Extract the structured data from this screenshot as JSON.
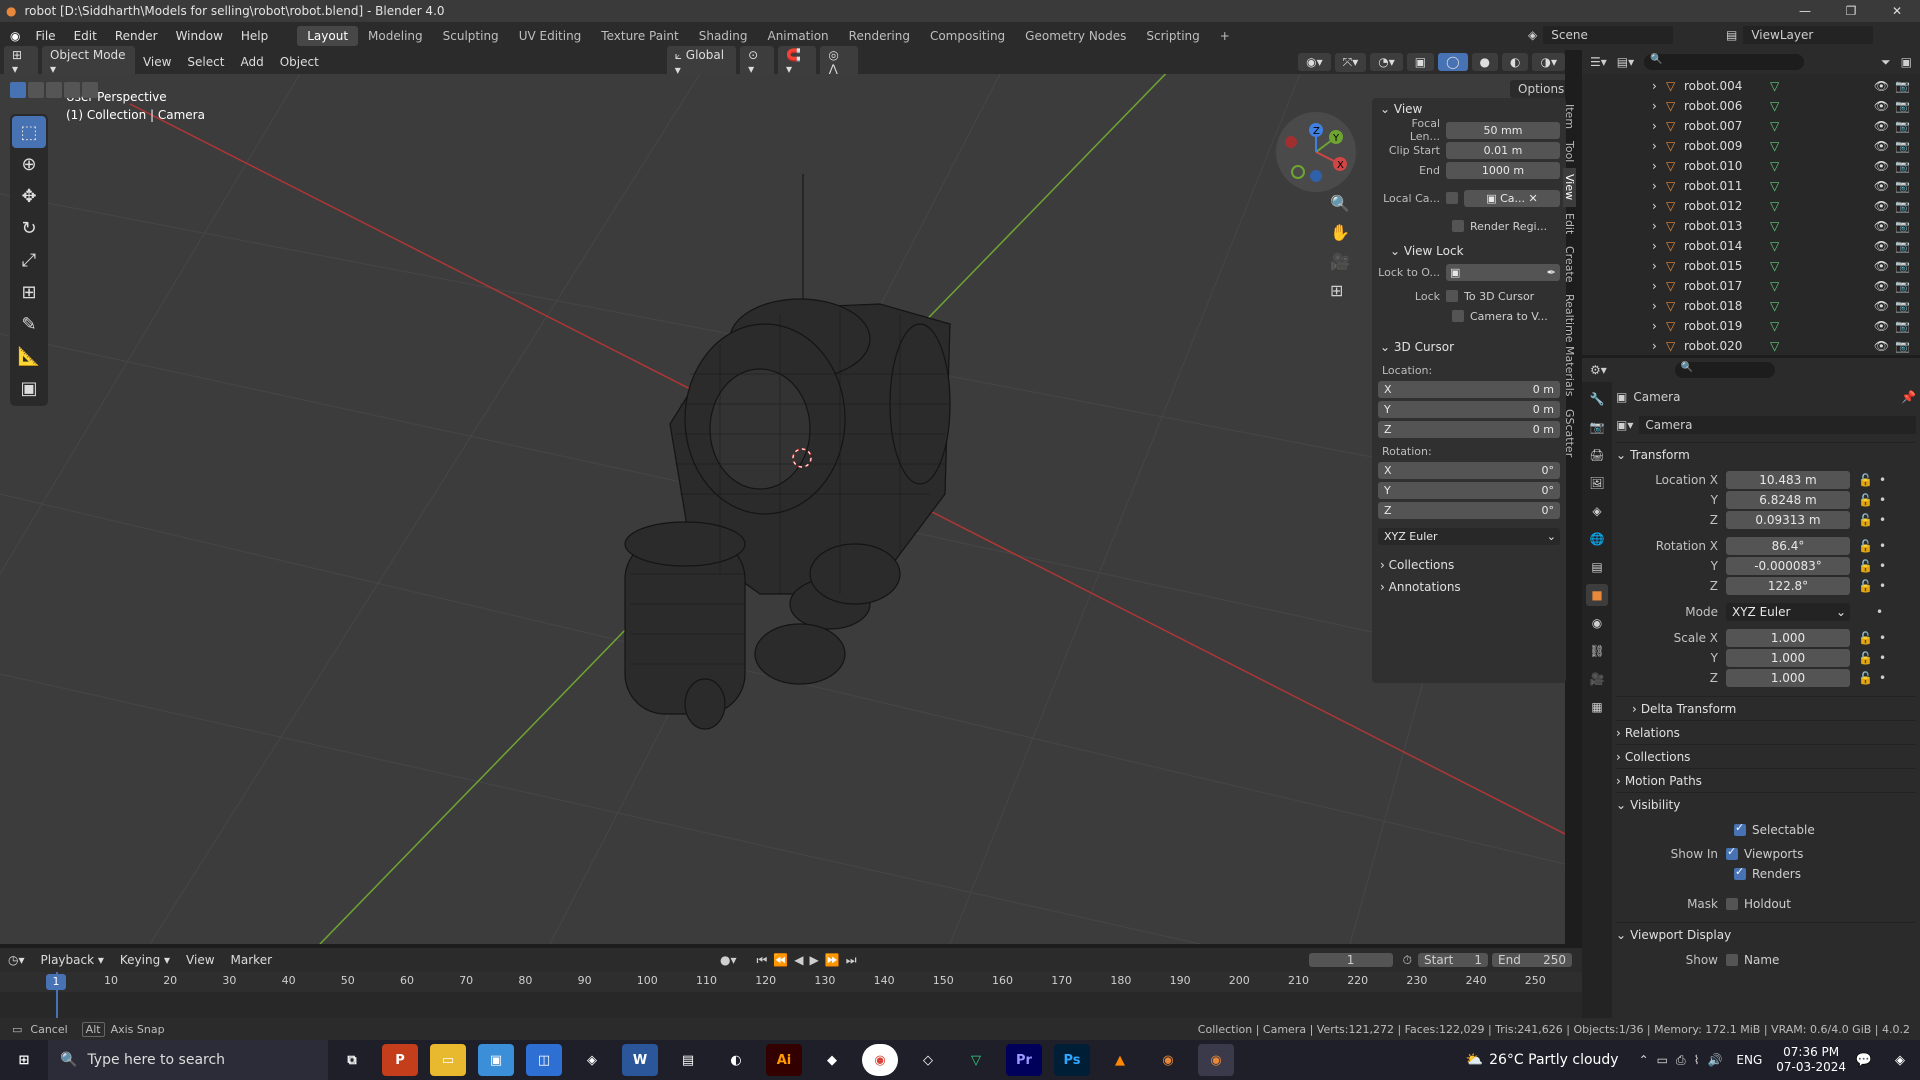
{
  "titlebar": {
    "title": "robot [D:\\Siddharth\\Models for selling\\robot\\robot.blend] - Blender 4.0"
  },
  "menu": {
    "file": "File",
    "edit": "Edit",
    "render": "Render",
    "window": "Window",
    "help": "Help"
  },
  "workspaces": [
    "Layout",
    "Modeling",
    "Sculpting",
    "UV Editing",
    "Texture Paint",
    "Shading",
    "Animation",
    "Rendering",
    "Compositing",
    "Geometry Nodes",
    "Scripting"
  ],
  "scene": {
    "name": "Scene",
    "viewlayer": "ViewLayer"
  },
  "vp_header": {
    "mode": "Object Mode",
    "view": "View",
    "select": "Select",
    "add": "Add",
    "object": "Object",
    "orientation": "Global",
    "options": "Options"
  },
  "viewport": {
    "perspective": "User Perspective",
    "collection_info": "(1) Collection | Camera"
  },
  "npanel": {
    "view_section": "View",
    "focal_label": "Focal Len...",
    "focal": "50 mm",
    "clip_start_label": "Clip Start",
    "clip_start": "0.01 m",
    "end_label": "End",
    "end": "1000 m",
    "local_cam_label": "Local Ca...",
    "local_cam_value": "Ca...",
    "render_region": "Render Regi...",
    "view_lock_section": "View Lock",
    "lock_to_label": "Lock to O...",
    "lock_label": "Lock",
    "to_3d_cursor": "To 3D Cursor",
    "camera_to_view": "Camera to V...",
    "cursor_section": "3D Cursor",
    "location_label": "Location:",
    "loc_x": "0 m",
    "loc_y": "0 m",
    "loc_z": "0 m",
    "rotation_label": "Rotation:",
    "rot_x": "0°",
    "rot_y": "0°",
    "rot_z": "0°",
    "rot_mode": "XYZ Euler",
    "collections": "Collections",
    "annotations": "Annotations",
    "x": "X",
    "y": "Y",
    "z": "Z"
  },
  "sidetabs": [
    "Item",
    "Tool",
    "View",
    "Edit",
    "Create",
    "Realtime Materials",
    "GScatter"
  ],
  "outliner": {
    "items": [
      "robot.004",
      "robot.006",
      "robot.007",
      "robot.009",
      "robot.010",
      "robot.011",
      "robot.012",
      "robot.013",
      "robot.014",
      "robot.015",
      "robot.017",
      "robot.018",
      "robot.019",
      "robot.020"
    ]
  },
  "properties": {
    "object_name": "Camera",
    "data_name": "Camera",
    "transform": "Transform",
    "location_x_label": "Location X",
    "loc_x": "10.483 m",
    "loc_y": "6.8248 m",
    "loc_z": "0.09313 m",
    "rotation_x_label": "Rotation X",
    "rot_x": "86.4°",
    "rot_y": "-0.000083°",
    "rot_z": "122.8°",
    "mode_label": "Mode",
    "mode": "XYZ Euler",
    "scale_x_label": "Scale X",
    "scale_x": "1.000",
    "scale_y": "1.000",
    "scale_z": "1.000",
    "y": "Y",
    "z": "Z",
    "delta_transform": "Delta Transform",
    "relations": "Relations",
    "collections": "Collections",
    "motion_paths": "Motion Paths",
    "visibility": "Visibility",
    "selectable": "Selectable",
    "show_in_label": "Show In",
    "viewports": "Viewports",
    "renders": "Renders",
    "mask_label": "Mask",
    "holdout": "Holdout",
    "viewport_display": "Viewport Display",
    "show_label": "Show",
    "name": "Name"
  },
  "timeline": {
    "playback": "Playback",
    "keying": "Keying",
    "view": "View",
    "marker": "Marker",
    "current_frame": "1",
    "start_label": "Start",
    "start": "1",
    "end_label": "End",
    "end": "250",
    "ticks": [
      "10",
      "20",
      "30",
      "40",
      "50",
      "60",
      "70",
      "80",
      "90",
      "100",
      "110",
      "120",
      "130",
      "140",
      "150",
      "160",
      "170",
      "180",
      "190",
      "200",
      "210",
      "220",
      "230",
      "240",
      "250"
    ],
    "playhead": "1"
  },
  "statusbar": {
    "cancel": "Cancel",
    "alt": "Alt",
    "axis_snap": "Axis Snap",
    "stats": "Collection | Camera | Verts:121,272 | Faces:122,029 | Tris:241,626 | Objects:1/36 | Memory: 172.1 MiB | VRAM: 0.6/4.0 GiB | 4.0.2"
  },
  "taskbar": {
    "search_placeholder": "Type here to search",
    "weather": "26°C  Partly cloudy",
    "lang": "ENG",
    "time": "07:36 PM",
    "date": "07-03-2024"
  },
  "colors": {
    "accent": "#4772b3",
    "x_axis": "#b03636",
    "y_axis": "#6ea531",
    "outliner_icon": "#e8883a",
    "mesh_icon": "#5fcf7a"
  }
}
